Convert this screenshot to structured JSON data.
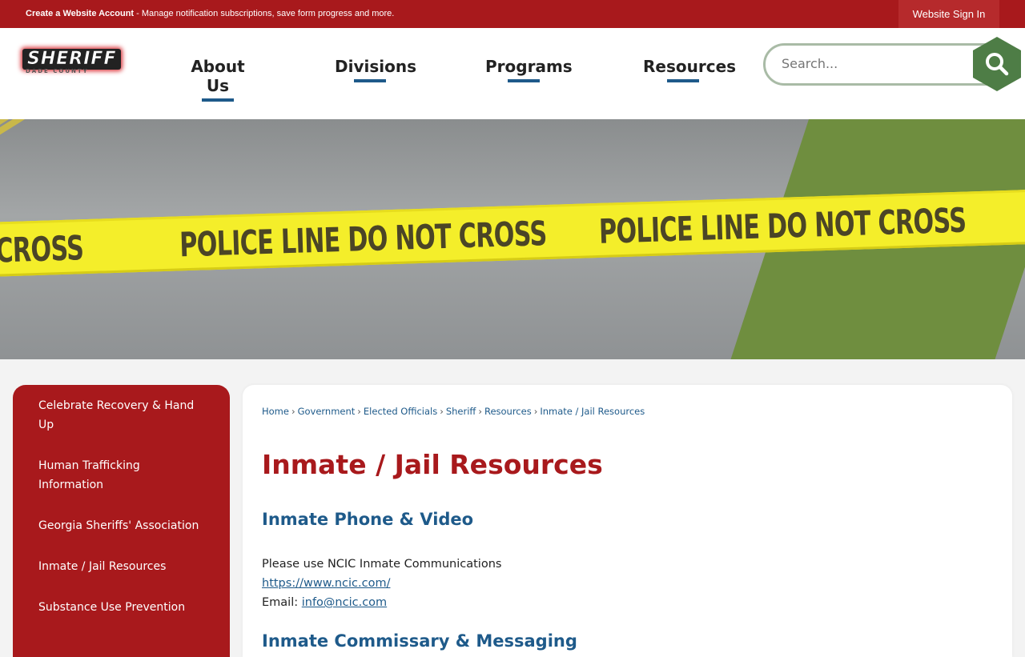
{
  "topbar": {
    "create_account_label": "Create a Website Account",
    "create_account_desc": " - Manage notification subscriptions, save form progress and more.",
    "sign_in_label": "Website Sign In"
  },
  "logo": {
    "line1": "SHERIFF",
    "line2": "DADE COUNTY"
  },
  "nav": {
    "items": [
      {
        "label": "About Us"
      },
      {
        "label": "Divisions"
      },
      {
        "label": "Programs"
      },
      {
        "label": "Resources"
      }
    ]
  },
  "search": {
    "placeholder": "Search..."
  },
  "hero": {
    "tape_text": "POLICE LINE DO NOT CROSS",
    "tape_fragment": "CROSS"
  },
  "sidebar": {
    "items": [
      {
        "label": "Celebrate Recovery & Hand Up"
      },
      {
        "label": "Human Trafficking Information"
      },
      {
        "label": "Georgia Sheriffs' Association"
      },
      {
        "label": "Inmate / Jail Resources"
      },
      {
        "label": "Substance Use Prevention"
      }
    ]
  },
  "breadcrumb": {
    "items": [
      {
        "label": "Home"
      },
      {
        "label": "Government"
      },
      {
        "label": "Elected Officials"
      },
      {
        "label": "Sheriff"
      },
      {
        "label": "Resources"
      },
      {
        "label": "Inmate / Jail Resources"
      }
    ],
    "separator": "›"
  },
  "main": {
    "title": "Inmate / Jail Resources",
    "section1_title": "Inmate Phone  & Video",
    "line1": "Please use NCIC Inmate Communications",
    "link1": "https://www.ncic.com/",
    "email_label": "Email: ",
    "email_link": "info@ncic.com",
    "section2_title": "Inmate Commissary & Messaging"
  },
  "colors": {
    "brand_red": "#a8191c",
    "link_blue": "#1e5a8a",
    "search_green": "#4e7d46"
  }
}
